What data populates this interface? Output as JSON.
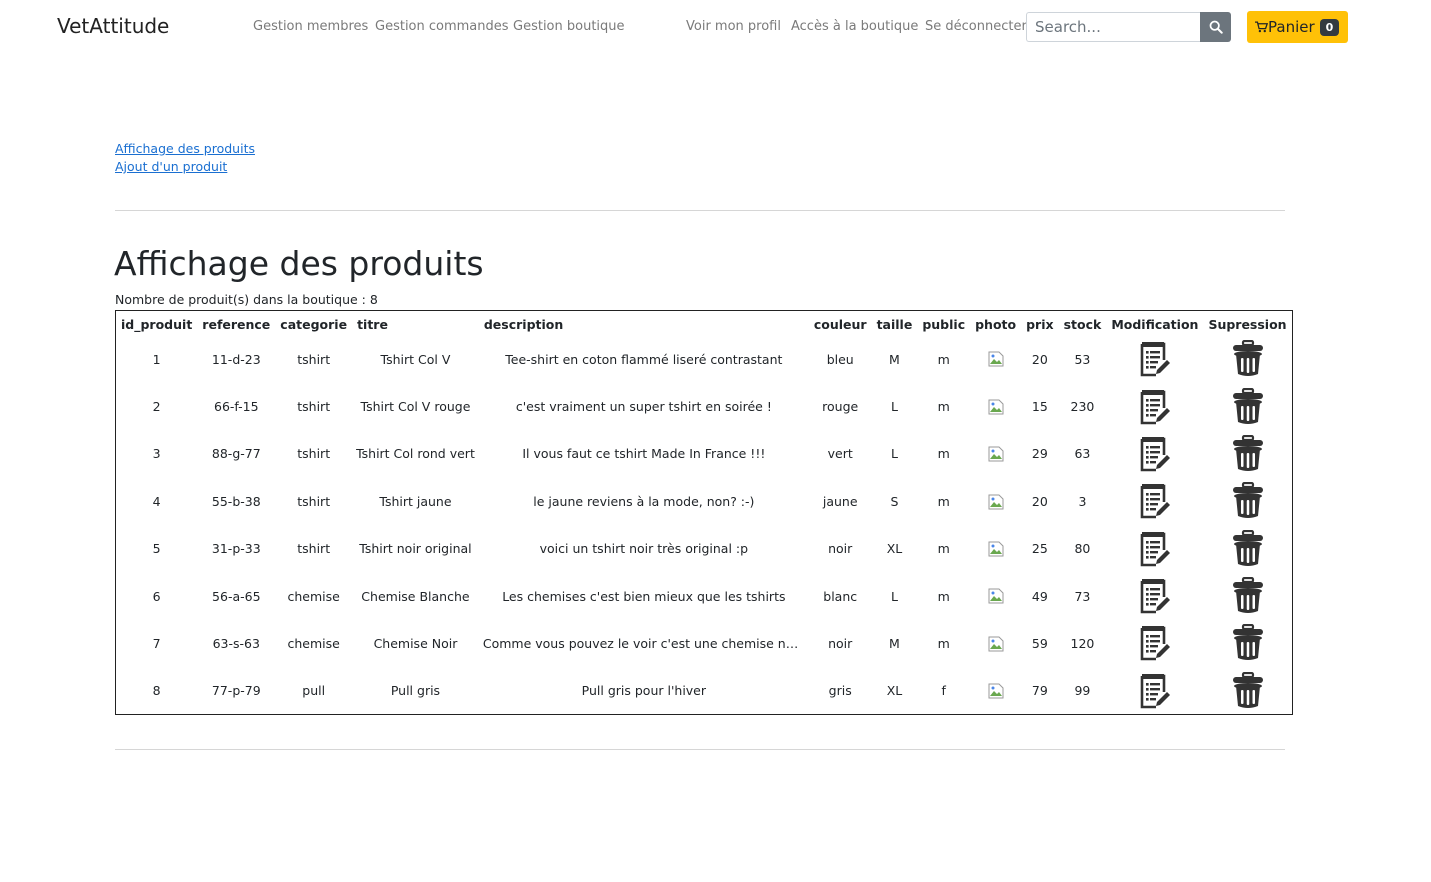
{
  "navbar": {
    "brand": "VetAttitude",
    "admin_links": [
      "Gestion membres",
      "Gestion commandes",
      "Gestion boutique"
    ],
    "user_links": [
      "Voir mon profil",
      "Accès à la boutique",
      "Se déconnecter"
    ],
    "search_placeholder": "Search...",
    "search_icon": "search-icon",
    "cart_label": "Panier",
    "cart_count": "0",
    "cart_icon": "shopping-cart-icon"
  },
  "sub_nav": {
    "links": [
      "Affichage des produits",
      "Ajout d'un produit"
    ]
  },
  "main": {
    "title": "Affichage des produits",
    "count_text": "Nombre de produit(s) dans la boutique : 8",
    "table": {
      "headers": [
        "id_produit",
        "reference",
        "categorie",
        "titre",
        "description",
        "couleur",
        "taille",
        "public",
        "photo",
        "prix",
        "stock",
        "Modification",
        "Supression"
      ],
      "rows": [
        [
          "1",
          "11-d-23",
          "tshirt",
          "Tshirt Col V",
          "Tee-shirt en coton flammé liseré contrastant",
          "bleu",
          "M",
          "m",
          "20",
          "53"
        ],
        [
          "2",
          "66-f-15",
          "tshirt",
          "Tshirt Col V rouge",
          "c'est vraiment un super tshirt en soirée !",
          "rouge",
          "L",
          "m",
          "15",
          "230"
        ],
        [
          "3",
          "88-g-77",
          "tshirt",
          "Tshirt Col rond vert",
          "Il vous faut ce tshirt Made In France !!!",
          "vert",
          "L",
          "m",
          "29",
          "63"
        ],
        [
          "4",
          "55-b-38",
          "tshirt",
          "Tshirt jaune",
          "le jaune reviens à la mode, non? :-)",
          "jaune",
          "S",
          "m",
          "20",
          "3"
        ],
        [
          "5",
          "31-p-33",
          "tshirt",
          "Tshirt noir original",
          "voici un tshirt noir très original :p",
          "noir",
          "XL",
          "m",
          "25",
          "80"
        ],
        [
          "6",
          "56-a-65",
          "chemise",
          "Chemise Blanche",
          "Les chemises c'est bien mieux que les tshirts",
          "blanc",
          "L",
          "m",
          "49",
          "73"
        ],
        [
          "7",
          "63-s-63",
          "chemise",
          "Chemise Noir",
          "Comme vous pouvez le voir c'est une chemise noir...",
          "noir",
          "M",
          "m",
          "59",
          "120"
        ],
        [
          "8",
          "77-p-79",
          "pull",
          "Pull gris",
          "Pull gris pour l'hiver",
          "gris",
          "XL",
          "f",
          "79",
          "99"
        ]
      ],
      "photo_icon": "broken-image-icon",
      "edit_icon": "edit-document-icon",
      "delete_icon": "trash-icon"
    }
  },
  "colors": {
    "cart_button": "#ffc107",
    "search_button": "#6c757d",
    "link": "#1a6fd1",
    "icon": "#333333"
  }
}
